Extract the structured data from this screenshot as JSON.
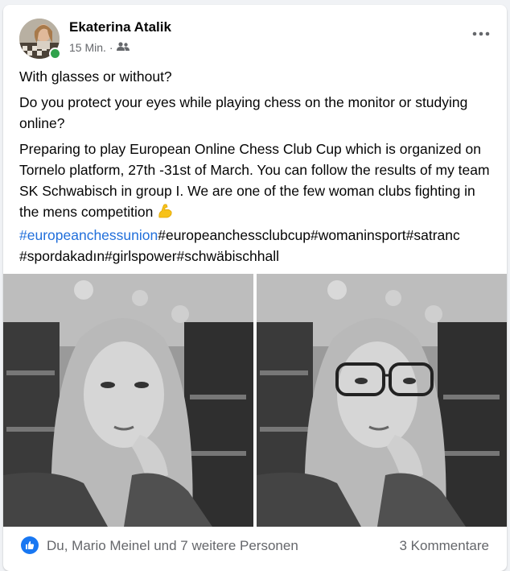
{
  "post": {
    "author": "Ekaterina Atalik",
    "time": "15 Min.",
    "audience_icon": "friends-icon",
    "more_icon": "more-horizontal-icon",
    "paragraphs": [
      "With glasses or without?",
      "Do you protect your eyes while playing chess on the monitor or studying online?",
      "Preparing to play European Online Chess Club Cup which is organized on Tornelo platform, 27th -31st of March. You can follow the results of my team SK Schwabisch in group I. We are one of the few woman clubs fighting in the mens competition"
    ],
    "emoji": "flexed-biceps-icon",
    "hashtags": {
      "link": "#europeanchessunion",
      "rest_line1": "#europeanchessclubcup#womaninsport#satranc",
      "line2": "#spordakadın#girlspower#schwäbischhall"
    }
  },
  "photos": [
    {
      "alt": "Portrait without glasses"
    },
    {
      "alt": "Portrait with glasses"
    }
  ],
  "footer": {
    "reaction_icon": "like-icon",
    "reactions": "Du, Mario Meinel und 7 weitere Personen",
    "comments": "3 Kommentare"
  },
  "colors": {
    "link": "#216fdb",
    "online": "#31a24c",
    "like": "#1877f2",
    "secondary_text": "#65676b"
  }
}
